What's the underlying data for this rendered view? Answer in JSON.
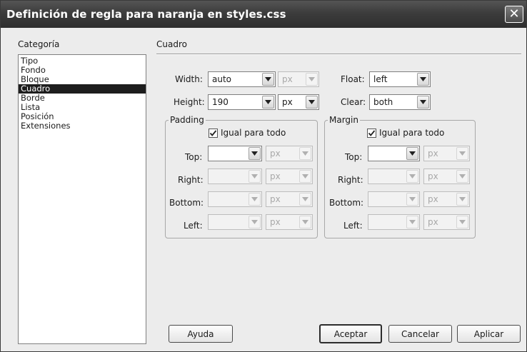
{
  "window": {
    "title": "Definición de regla para naranja en styles.css",
    "close_glyph": "✕"
  },
  "category": {
    "label": "Categoría",
    "items": [
      "Tipo",
      "Fondo",
      "Bloque",
      "Cuadro",
      "Borde",
      "Lista",
      "Posición",
      "Extensiones"
    ],
    "selected": "Cuadro"
  },
  "section": {
    "title": "Cuadro"
  },
  "box": {
    "width": {
      "label": "Width:",
      "value": "auto",
      "unit": "px"
    },
    "height": {
      "label": "Height:",
      "value": "190",
      "unit": "px"
    },
    "float": {
      "label": "Float:",
      "value": "left"
    },
    "clear": {
      "label": "Clear:",
      "value": "both"
    }
  },
  "padding": {
    "legend": "Padding",
    "same_label": "Igual para todo",
    "same_checked": true,
    "top": {
      "label": "Top:",
      "value": "",
      "unit": "px"
    },
    "right": {
      "label": "Right:",
      "value": "",
      "unit": "px"
    },
    "bottom": {
      "label": "Bottom:",
      "value": "",
      "unit": "px"
    },
    "left": {
      "label": "Left:",
      "value": "",
      "unit": "px"
    }
  },
  "margin": {
    "legend": "Margin",
    "same_label": "Igual para todo",
    "same_checked": true,
    "top": {
      "label": "Top:",
      "value": "",
      "unit": "px"
    },
    "right": {
      "label": "Right:",
      "value": "",
      "unit": "px"
    },
    "bottom": {
      "label": "Bottom:",
      "value": "",
      "unit": "px"
    },
    "left": {
      "label": "Left:",
      "value": "",
      "unit": "px"
    }
  },
  "buttons": {
    "help": "Ayuda",
    "ok": "Aceptar",
    "cancel": "Cancelar",
    "apply": "Aplicar"
  },
  "colors": {
    "titlebar": "#3c3c3c",
    "selection": "#1e1e1e",
    "dialog_bg": "#ececec"
  }
}
